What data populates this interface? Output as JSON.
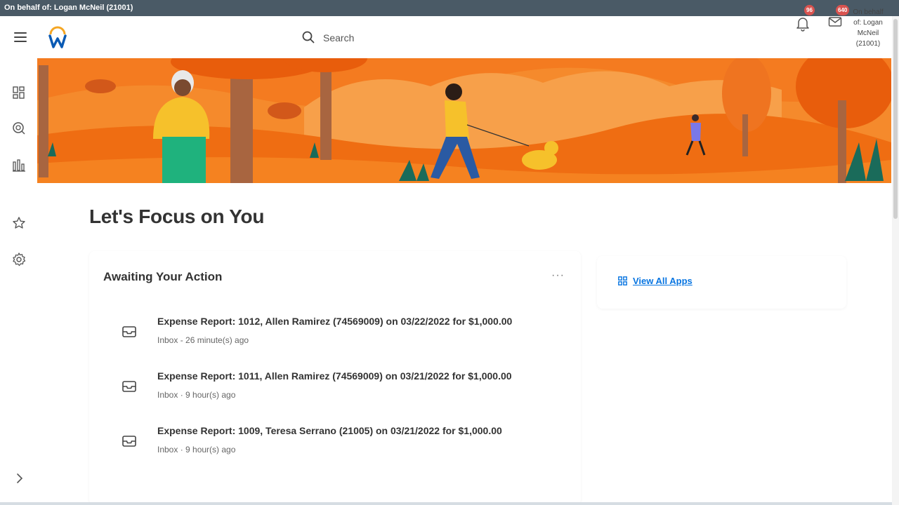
{
  "topbar": {
    "text": "On behalf of: Logan McNeil (21001)"
  },
  "header": {
    "search_placeholder": "Search",
    "notifications_count": "96",
    "inbox_count": "640",
    "avatar_alt": "On behalf of: Logan McNeil (21001)"
  },
  "page": {
    "title": "Let's Focus on You"
  },
  "awaiting": {
    "title": "Awaiting Your Action",
    "items": [
      {
        "title": "Expense Report: 1012, Allen Ramirez (74569009) on 03/22/2022 for $1,000.00",
        "subtitle": "Inbox - 26 minute(s) ago"
      },
      {
        "title": "Expense Report: 1011, Allen Ramirez (74569009) on 03/21/2022 for $1,000.00",
        "subtitle": "Inbox · 9 hour(s) ago"
      },
      {
        "title": "Expense Report: 1009, Teresa Serrano (21005) on 03/21/2022 for $1,000.00",
        "subtitle": "Inbox · 9 hour(s) ago"
      }
    ]
  },
  "apps": {
    "view_all_label": "View All Apps"
  },
  "colors": {
    "topbar": "#4a5a66",
    "accent_link": "#0875e1",
    "badge": "#d9534f",
    "banner_orange": "#f47b20"
  }
}
